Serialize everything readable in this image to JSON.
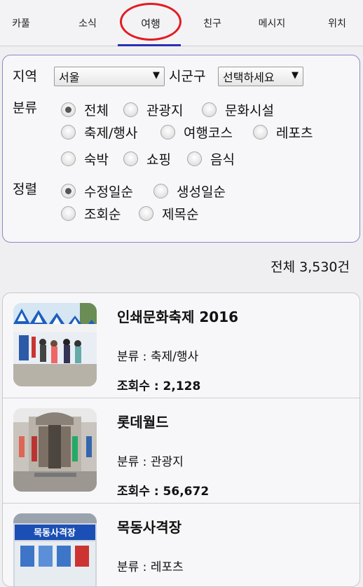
{
  "tabs": [
    {
      "label": "카풀"
    },
    {
      "label": "소식"
    },
    {
      "label": "여행"
    },
    {
      "label": "친구"
    },
    {
      "label": "메시지"
    },
    {
      "label": "위치"
    }
  ],
  "active_tab": "여행",
  "colors": {
    "accent_underline": "#2a2fb0",
    "highlight_circle": "#e31b23",
    "filter_border": "#8c88c8"
  },
  "filter": {
    "region_label": "지역",
    "region_value": "서울",
    "district_label": "시군구",
    "district_value": "선택하세요",
    "category_label": "분류",
    "categories": [
      {
        "label": "전체",
        "selected": true
      },
      {
        "label": "관광지",
        "selected": false
      },
      {
        "label": "문화시설",
        "selected": false
      },
      {
        "label": "축제/행사",
        "selected": false
      },
      {
        "label": "여행코스",
        "selected": false
      },
      {
        "label": "레포츠",
        "selected": false
      },
      {
        "label": "숙박",
        "selected": false
      },
      {
        "label": "쇼핑",
        "selected": false
      },
      {
        "label": "음식",
        "selected": false
      }
    ],
    "sort_label": "정렬",
    "sorts": [
      {
        "label": "수정일순",
        "selected": true
      },
      {
        "label": "생성일순",
        "selected": false
      },
      {
        "label": "조회순",
        "selected": false
      },
      {
        "label": "제목순",
        "selected": false
      }
    ]
  },
  "total_count": "전체 3,530건",
  "items": [
    {
      "title": "인쇄문화축제 2016",
      "category": "분류 : 축제/행사",
      "views": "조회수 : 2,128",
      "thumb_icon": "festival-tents-photo"
    },
    {
      "title": "롯데월드",
      "category": "분류 : 관광지",
      "views": "조회수 : 56,672",
      "thumb_icon": "building-photo"
    },
    {
      "title": "목동사격장",
      "category": "분류 : 레포츠",
      "views": "",
      "thumb_icon": "shooting-range-sign-photo"
    }
  ],
  "thumb_texts": {
    "sign": "목동사격장"
  }
}
